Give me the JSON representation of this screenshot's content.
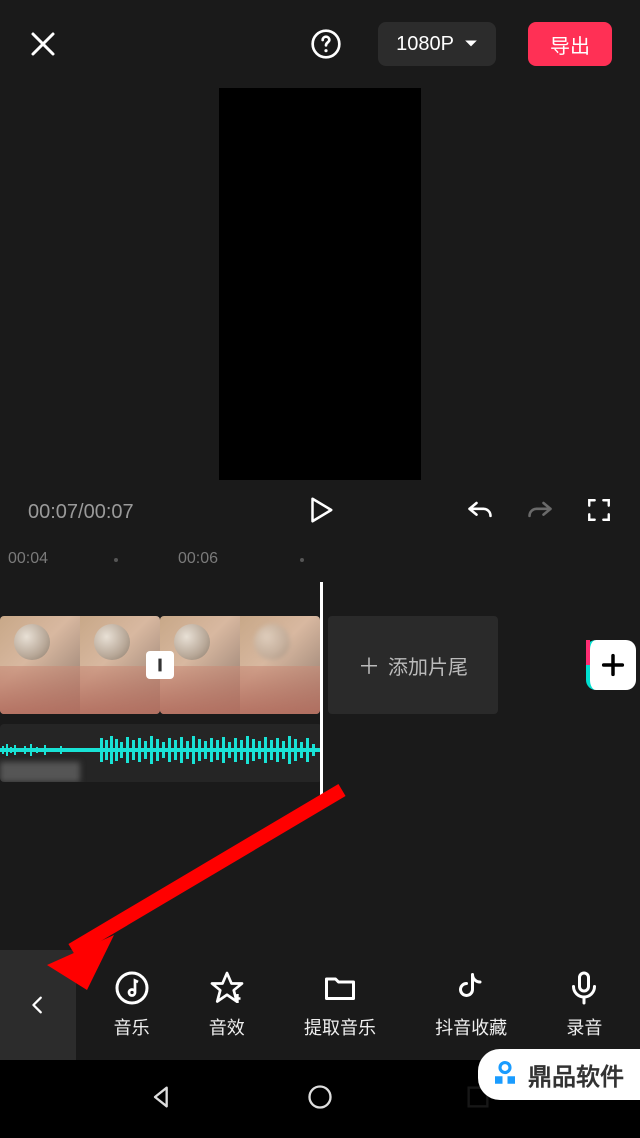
{
  "header": {
    "resolution": "1080P",
    "export_label": "导出"
  },
  "playback": {
    "time_display": "00:07/00:07"
  },
  "ruler": {
    "mark1": "00:04",
    "mark2": "00:06"
  },
  "timeline": {
    "add_ending_label": "添加片尾"
  },
  "tools": {
    "music": "音乐",
    "sound_effect": "音效",
    "extract_music": "提取音乐",
    "douyin_fav": "抖音收藏",
    "record": "录音"
  },
  "watermark": {
    "text": "鼎品软件"
  },
  "colors": {
    "accent": "#ff3055",
    "wave": "#19e3d6"
  }
}
